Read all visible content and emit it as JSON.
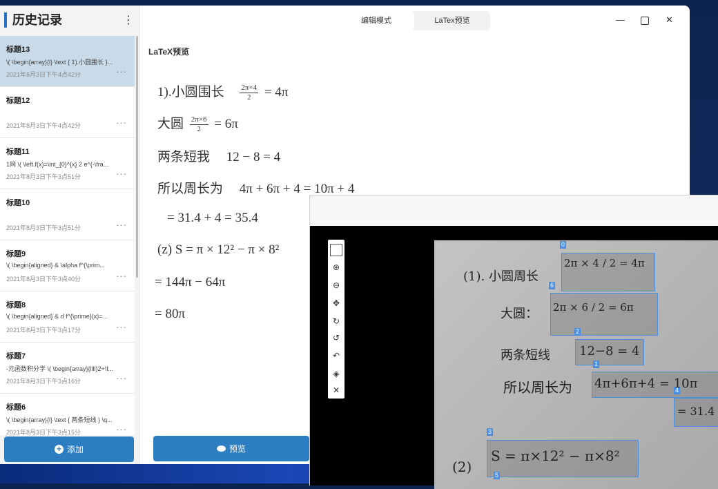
{
  "sidebar": {
    "title": "历史记录",
    "menu_icon": "⋮",
    "items": [
      {
        "title": "标题13",
        "subtitle": "\\( \\begin{array}{l} \\text { 1).小圆围长 }...",
        "date": "2021年8月3日下午4点42分",
        "selected": true
      },
      {
        "title": "标题12",
        "subtitle": "",
        "date": "2021年8月3日下午4点42分",
        "selected": false
      },
      {
        "title": "标题11",
        "subtitle": "1网 \\( \\left.f(x)=\\int_{0}^{x} 2 e^{-\\fra...",
        "date": "2021年8月3日下午3点51分",
        "selected": false
      },
      {
        "title": "标题10",
        "subtitle": "",
        "date": "2021年8月3日下午3点51分",
        "selected": false
      },
      {
        "title": "标题9",
        "subtitle": "\\( \\begin{aligned} & \\alpha f^{\\prim...",
        "date": "2021年8月3日下午3点40分",
        "selected": false
      },
      {
        "title": "标题8",
        "subtitle": "\\( \\begin{aligned} & d f^{\\prime}(x)=...",
        "date": "2021年8月3日下午3点17分",
        "selected": false
      },
      {
        "title": "标题7",
        "subtitle": "-元函数积分学 \\( \\begin{array}{llll}2+\\f...",
        "date": "2021年8月3日下午3点16分",
        "selected": false
      },
      {
        "title": "标题6",
        "subtitle": "\\( \\begin{array}{l} \\text { 两条短线 } \\q...",
        "date": "2021年8月3日下午3点15分",
        "selected": false
      }
    ],
    "add_button": "添加"
  },
  "tabs": [
    "编辑模式",
    "LaTex预览"
  ],
  "window_controls": {
    "minimize": "—",
    "maximize": "",
    "close": "✕"
  },
  "preview": {
    "label": "LaTeX预览",
    "line1": {
      "text": "1).小圆围长",
      "frac_num": "2π×4",
      "frac_den": "2",
      "rest": "= 4π"
    },
    "line2": {
      "text": "大圆",
      "frac_num": "2π×6",
      "frac_den": "2",
      "rest": "= 6π"
    },
    "line3": "两条短我　 12 − 8 = 4",
    "line4": "所以周长为　 4π + 6π + 4 = 10π + 4",
    "line5": "= 31.4 + 4 = 35.4",
    "line6": "(z) S = π × 12² − π × 8²",
    "line7": "= 144π − 64π",
    "line8": "= 80π",
    "button": "预览"
  },
  "ocr_view": {
    "tools": [
      "square-select-icon",
      "zoom-in-icon",
      "zoom-out-icon",
      "move-icon",
      "rotate-cw-icon",
      "rotate-ccw-icon",
      "undo-icon",
      "eraser-icon",
      "close-icon"
    ],
    "handwriting": {
      "line1": "(1). 小圆周长",
      "frac1": "2π × 4 / 2 = 4π",
      "line2": "大圆：",
      "frac2": "2π × 6 / 2 = 6π",
      "line3": "两条短线",
      "expr3": "12−8 = 4",
      "line4": "所以周长为",
      "expr4": "4π+6π+4 = 10π",
      "expr5": "= 31.4",
      "line6": "(2)",
      "expr6": "S = π×12² − π×8²"
    },
    "tags": [
      "0",
      "6",
      "2",
      "1",
      "4",
      "3",
      "5"
    ]
  },
  "colors": {
    "accent": "#2c7dc2",
    "selected_row": "#c9dbe8",
    "ocr_box": "#4b8fe0"
  }
}
